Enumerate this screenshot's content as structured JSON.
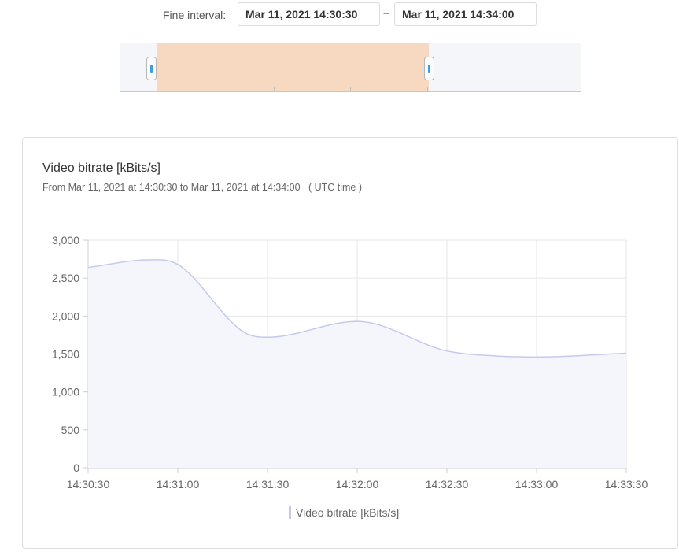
{
  "interval": {
    "label": "Fine interval:",
    "from": "Mar 11, 2021 14:30:30",
    "separator": "–",
    "to": "Mar 11, 2021 14:34:00"
  },
  "slider": {
    "selection_start_fraction": 0.084,
    "selection_end_fraction": 0.666
  },
  "chart": {
    "title": "Video bitrate [kBits/s]",
    "subtitle": "From Mar 11, 2021 at 14:30:30 to Mar 11, 2021 at 14:34:00   ( UTC time )"
  },
  "chart_data": {
    "type": "area",
    "title": "Video bitrate [kBits/s]",
    "xlabel": "",
    "ylabel": "",
    "x_ticks": [
      "14:30:30",
      "14:31:00",
      "14:31:30",
      "14:32:00",
      "14:32:30",
      "14:33:00",
      "14:33:30"
    ],
    "y_ticks": [
      "0",
      "500",
      "1,000",
      "1,500",
      "2,000",
      "2,500",
      "3,000"
    ],
    "ylim": [
      0,
      3000
    ],
    "xlim_seconds": [
      0,
      180
    ],
    "grid": true,
    "legend_position": "bottom",
    "series": [
      {
        "name": "Video bitrate [kBits/s]",
        "color": "#c5caec",
        "fill": "#f5f6fc",
        "points": [
          [
            "14:30:30",
            2640
          ],
          [
            "14:30:50",
            2740
          ],
          [
            "14:31:00",
            2680
          ],
          [
            "14:31:22",
            1790
          ],
          [
            "14:31:30",
            1720
          ],
          [
            "14:32:00",
            1930
          ],
          [
            "14:32:30",
            1540
          ],
          [
            "14:32:46",
            1475
          ],
          [
            "14:33:00",
            1460
          ],
          [
            "14:33:30",
            1510
          ]
        ]
      }
    ]
  }
}
